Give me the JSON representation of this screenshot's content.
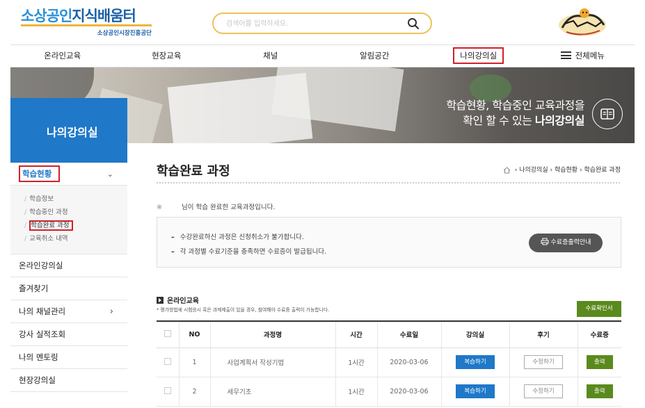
{
  "header": {
    "logo_part1": "소상공인",
    "logo_part2": "지식배움터",
    "logo_sub": "소상공인시장진흥공단",
    "search_placeholder": "검색어를 입력하세요."
  },
  "nav": {
    "items": [
      {
        "label": "온라인교육"
      },
      {
        "label": "현장교육"
      },
      {
        "label": "채널"
      },
      {
        "label": "알림공간"
      },
      {
        "label": "나의강의실",
        "active": true
      },
      {
        "label": "전체메뉴"
      }
    ]
  },
  "banner": {
    "line1": "학습현황, 학습중인 교육과정을",
    "line2_prefix": "확인 할 수 있는 ",
    "line2_bold": "나의강의실"
  },
  "sidebar": {
    "title": "나의강의실",
    "open_menu": "학습현황",
    "sub_items": [
      "학습정보",
      "학습중인 과정",
      "학습완료 과정",
      "교육취소 내역"
    ],
    "menus": [
      "온라인강의실",
      "즐겨찾기",
      "나의 채널관리",
      "강사 실적조회",
      "나의 멘토링",
      "현장강의실"
    ]
  },
  "content": {
    "title": "학습완료 과정",
    "breadcrumb": [
      "나의강의실",
      "학습현황",
      "학습완료 과정"
    ],
    "notice_mark": "※",
    "notice": "님이 학습 완료한 교육과정입니다.",
    "info_line1": "수강완료하신 과정은 신청취소가 불가합니다.",
    "info_line2": "각 과정별 수료기준을 충족하면 수료증이 발급됩니다.",
    "cert_guide_label": "수료증출력안내",
    "section_title": "온라인교육",
    "section_note": "* 평가방법에 시험응시 혹은 과제제출이 있을 경우, 참여해야 수료증 출력이 가능합니다.",
    "confirm_button": "수료확인서",
    "table": {
      "headers": [
        "NO",
        "과정명",
        "시간",
        "수료일",
        "강의실",
        "후기",
        "수료증"
      ],
      "rows": [
        {
          "no": "1",
          "name": "사업계획서 작성기법",
          "time": "1시간",
          "date": "2020-03-06",
          "room": "복습하기",
          "review": "수정하기",
          "cert": "출력"
        },
        {
          "no": "2",
          "name": "세무기초",
          "time": "1시간",
          "date": "2020-03-06",
          "room": "복습하기",
          "review": "수정하기",
          "cert": "출력"
        }
      ]
    }
  },
  "colors": {
    "brand_blue": "#1f78c8",
    "highlight_red": "#d0202a",
    "green": "#5a8a1e",
    "search_border": "#f0c05a"
  }
}
